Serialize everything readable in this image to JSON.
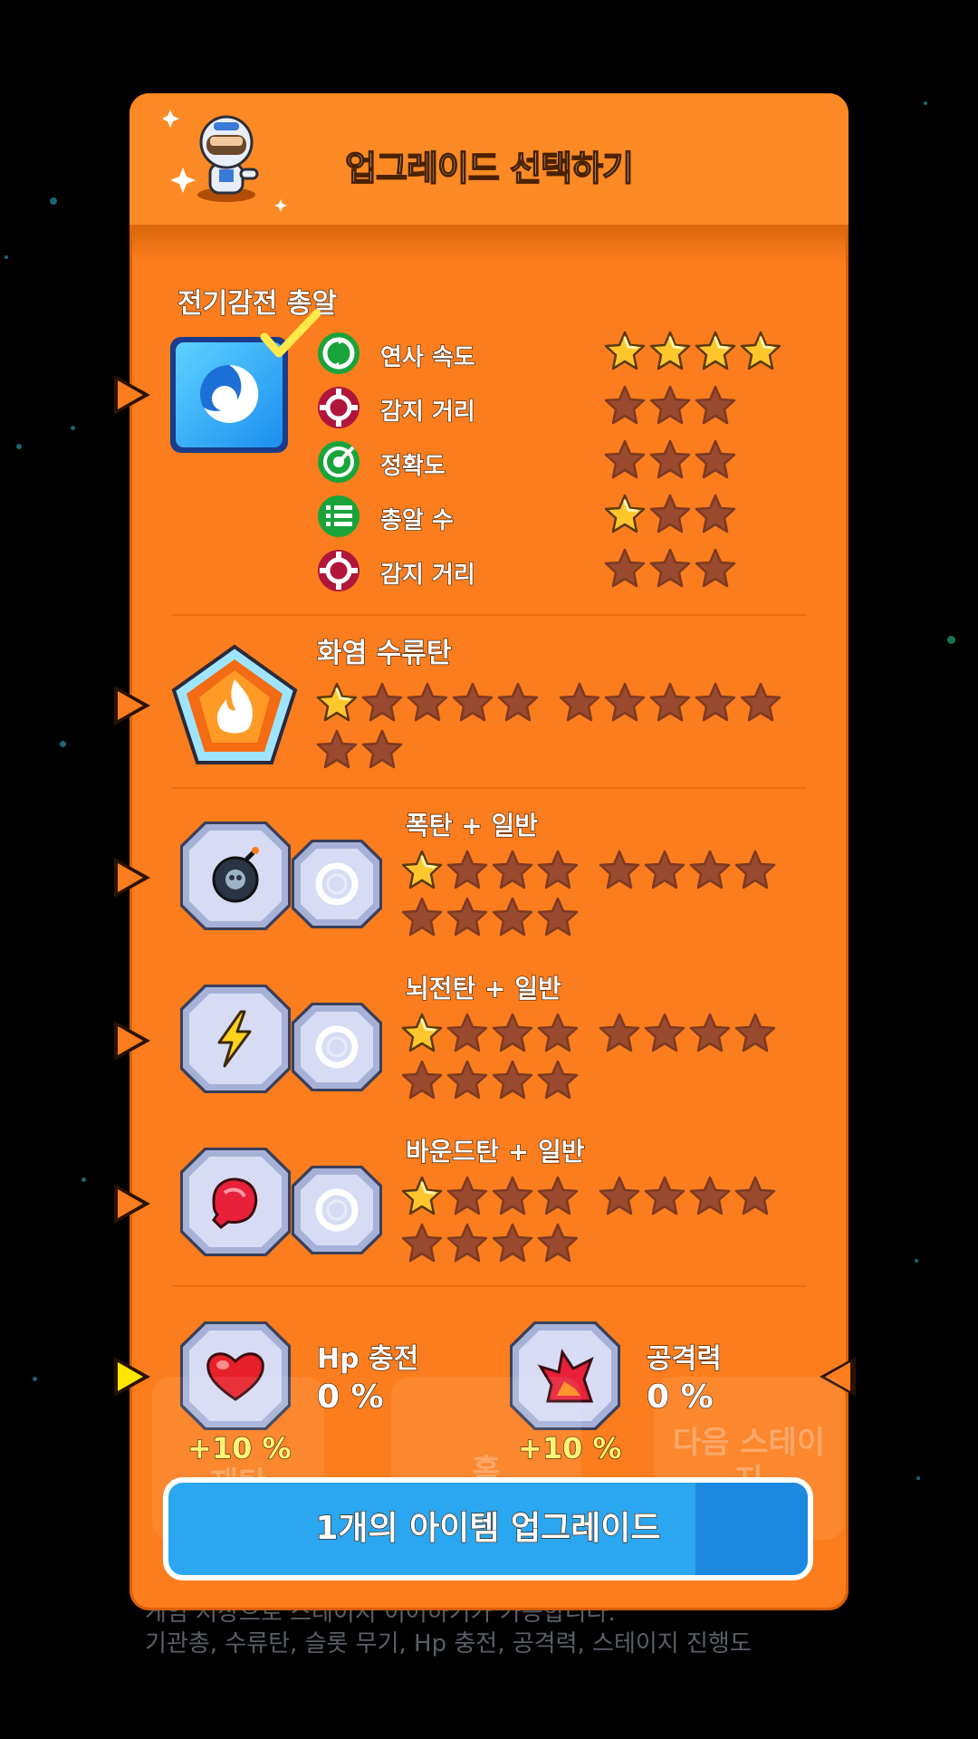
{
  "panel": {
    "title": "업그레이드 선택하기"
  },
  "weapon": {
    "name": "전기감전 총알",
    "stats": [
      {
        "label": "연사 속도",
        "icon": "rotate-icon",
        "filled": 4,
        "total": 4
      },
      {
        "label": "감지 거리",
        "icon": "target-reticle-icon",
        "filled": 0,
        "total": 3
      },
      {
        "label": "정확도",
        "icon": "accuracy-icon",
        "filled": 0,
        "total": 3
      },
      {
        "label": "총알 수",
        "icon": "list-icon",
        "filled": 1,
        "total": 3
      },
      {
        "label": "감지 거리",
        "icon": "target-reticle-icon",
        "filled": 0,
        "total": 3
      }
    ]
  },
  "grenade": {
    "name": "화염 수류탄",
    "filled": 1,
    "total": 12
  },
  "combos": [
    {
      "name": "폭탄 + 일반",
      "icon": "bomb-icon",
      "filled": 1,
      "total": 12
    },
    {
      "name": "뇌전탄 + 일반",
      "icon": "lightning-icon",
      "filled": 1,
      "total": 12
    },
    {
      "name": "바운드탄 + 일반",
      "icon": "boxing-glove-icon",
      "filled": 1,
      "total": 12
    }
  ],
  "boosts": [
    {
      "name": "Hp 충전",
      "value": "0 %",
      "bonus": "+10 %",
      "icon": "heart-icon"
    },
    {
      "name": "공격력",
      "value": "0 %",
      "bonus": "+10 %",
      "icon": "attack-burst-icon"
    }
  ],
  "upgrade_button": "1개의 아이템 업그레이드",
  "background": {
    "buttons": [
      "재탄",
      "홈",
      "다음 스테이지"
    ],
    "info_line1": "게임 저장으로 스테이지 이어하기가 가능합니다.",
    "info_line2": "기관총, 수류탄, 슬롯 무기, Hp 충전, 공격력, 스테이지 진행도"
  },
  "colors": {
    "panel": "#fb7d1d",
    "star_filled": "#ffc72c",
    "star_empty": "#9a4a2e",
    "button": "#2aa7f0"
  }
}
